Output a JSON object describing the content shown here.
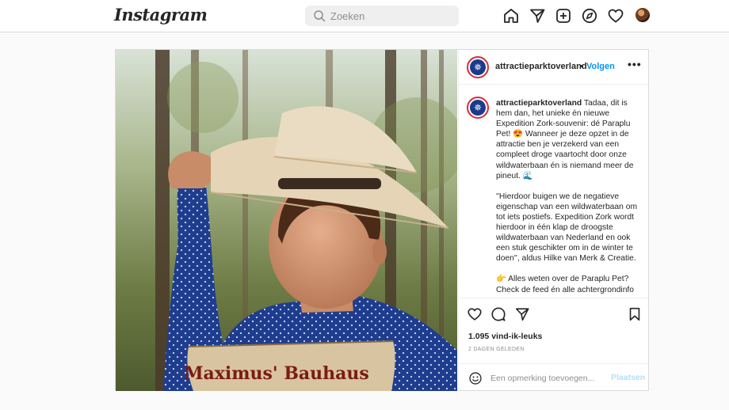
{
  "app": {
    "logo_text": "Instagram"
  },
  "search": {
    "placeholder": "Zoeken"
  },
  "nav": {
    "icons": [
      "home-icon",
      "direct-icon",
      "new-post-icon",
      "explore-icon",
      "activity-icon",
      "profile-avatar"
    ]
  },
  "post": {
    "username": "attractieparktoverland",
    "separator": "•",
    "follow_label": "Volgen",
    "more_label": "•••",
    "image_text": "Maximus' Bauhaus",
    "caption_paragraphs": [
      "Tadaa, dit is hem dan, het unieke én nieuwe Expedition Zork-souvenir: dé Paraplu Pet! 😍 Wanneer je deze opzet in de attractie ben je verzekerd van een compleet droge vaartocht door onze wildwaterbaan én is niemand meer de pineut. 🌊",
      "''Hierdoor buigen we de negatieve eigenschap van een wildwaterbaan om tot iets postiefs. Expedition Zork wordt hierdoor in één klap de droogste wildwaterbaan van Nederland en ook een stuk geschikter om in de winter te doen'', aldus Hilke van Merk & Creatie.",
      "👉 Alles weten over de Paraplu Pet? Check de feed én alle achtergrondinfo op de link in bio."
    ],
    "likes": "1.095 vind-ik-leuks",
    "date": "2 DAGEN GELEDEN",
    "comment_placeholder": "Een opmerking toevoegen...",
    "post_button": "Plaatsen"
  },
  "colors": {
    "link_blue": "#0095f6",
    "post_button_disabled": "#b2dffc",
    "avatar_ring": "#d62e3a",
    "avatar_bg": "#1d3a8a"
  }
}
